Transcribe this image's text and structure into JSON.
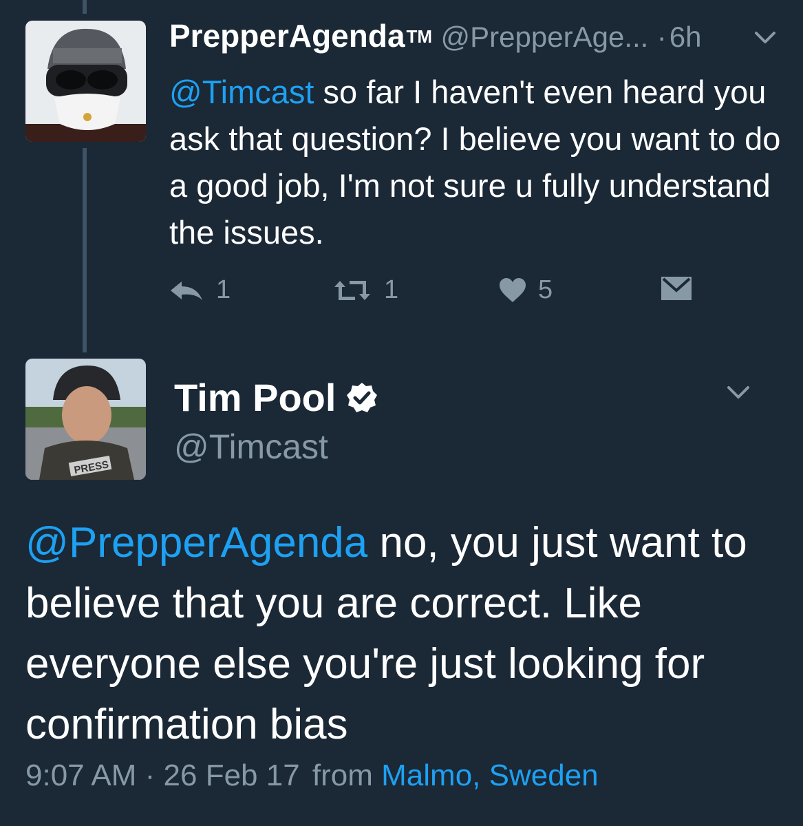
{
  "reply_tweet": {
    "display_name": "PrepperAgenda",
    "tm": "TM",
    "handle": "@PrepperAge...",
    "separator": "·",
    "time": "6h",
    "mention": "@Timcast",
    "text": " so far I haven't even heard you ask that question? I believe you want to do a good job, I'm not sure u fully understand the issues.",
    "reply_count": "1",
    "retweet_count": "1",
    "like_count": "5"
  },
  "main_tweet": {
    "display_name": "Tim Pool",
    "handle": "@Timcast",
    "mention": "@PrepperAgenda",
    "text": " no, you just want to believe that you are correct. Like everyone else you're just looking for confirmation bias",
    "timestamp": "9:07 AM · 26 Feb 17",
    "from_label": "from",
    "location": "Malmo, Sweden",
    "avatar_badge": "PRESS"
  },
  "colors": {
    "background": "#1b2836",
    "accent": "#1da1f2",
    "secondary_text": "#8899a6",
    "thread_line": "#3d5466"
  },
  "icons": [
    "reply-icon",
    "retweet-icon",
    "heart-icon",
    "direct-message-icon",
    "chevron-down-icon",
    "verified-badge-icon"
  ]
}
